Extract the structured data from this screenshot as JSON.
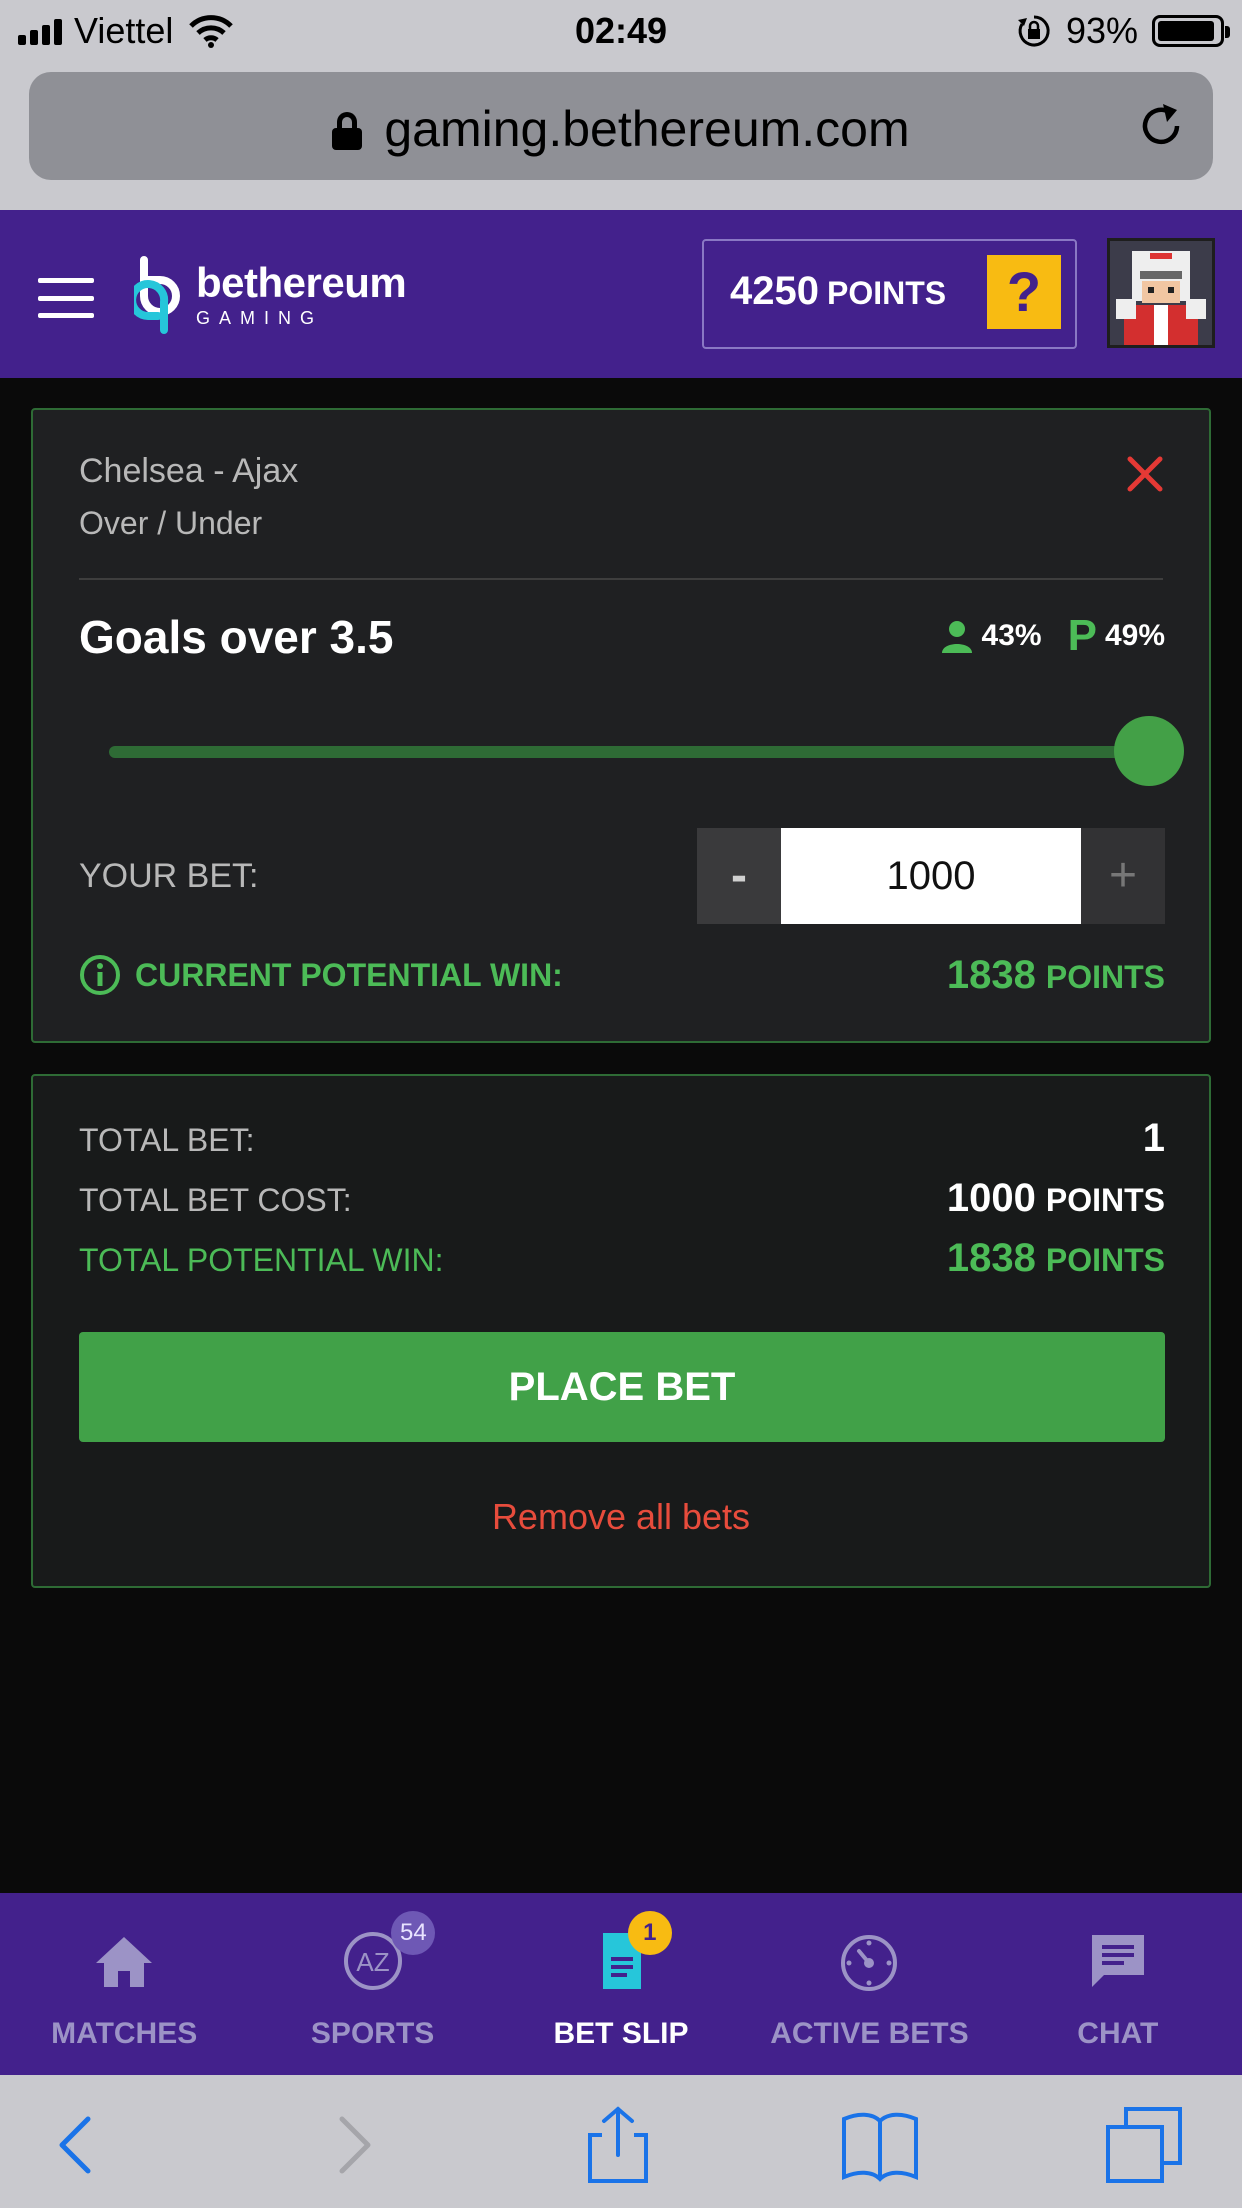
{
  "status_bar": {
    "carrier": "Viettel",
    "time": "02:49",
    "battery": "93%",
    "battery_level": 0.93
  },
  "browser": {
    "url": "gaming.bethereum.com"
  },
  "header": {
    "logo_name": "bethereum",
    "logo_sub": "GAMING",
    "points_value": "4250",
    "points_unit": "POINTS",
    "help_label": "?"
  },
  "bet": {
    "match": "Chelsea - Ajax",
    "market": "Over / Under",
    "selection": "Goals over 3.5",
    "user_pct": "43%",
    "p_icon": "P",
    "p_pct": "49%",
    "slider_level": 1.0,
    "your_bet_label": "YOUR BET:",
    "minus": "-",
    "plus": "+",
    "amount": "1000",
    "potential_label": "CURRENT POTENTIAL WIN:",
    "potential_value": "1838",
    "potential_unit": "POINTS"
  },
  "summary": {
    "total_bet_label": "TOTAL BET:",
    "total_bet_value": "1",
    "cost_label": "TOTAL BET COST:",
    "cost_value": "1000",
    "cost_unit": "POINTS",
    "win_label": "TOTAL POTENTIAL WIN:",
    "win_value": "1838",
    "win_unit": "POINTS",
    "place_bet": "PLACE BET",
    "remove_all": "Remove all bets"
  },
  "nav": {
    "items": [
      {
        "label": "MATCHES",
        "icon": "home-icon"
      },
      {
        "label": "SPORTS",
        "icon": "az-icon",
        "badge": "54"
      },
      {
        "label": "BET SLIP",
        "icon": "document-icon",
        "badge": "1",
        "active": true
      },
      {
        "label": "ACTIVE BETS",
        "icon": "timer-icon"
      },
      {
        "label": "CHAT",
        "icon": "chat-icon"
      }
    ]
  },
  "colors": {
    "brand_purple": "#43218c",
    "accent_green": "#41a148",
    "warning_yellow": "#f8bb12",
    "danger_red": "#e74c3c"
  }
}
